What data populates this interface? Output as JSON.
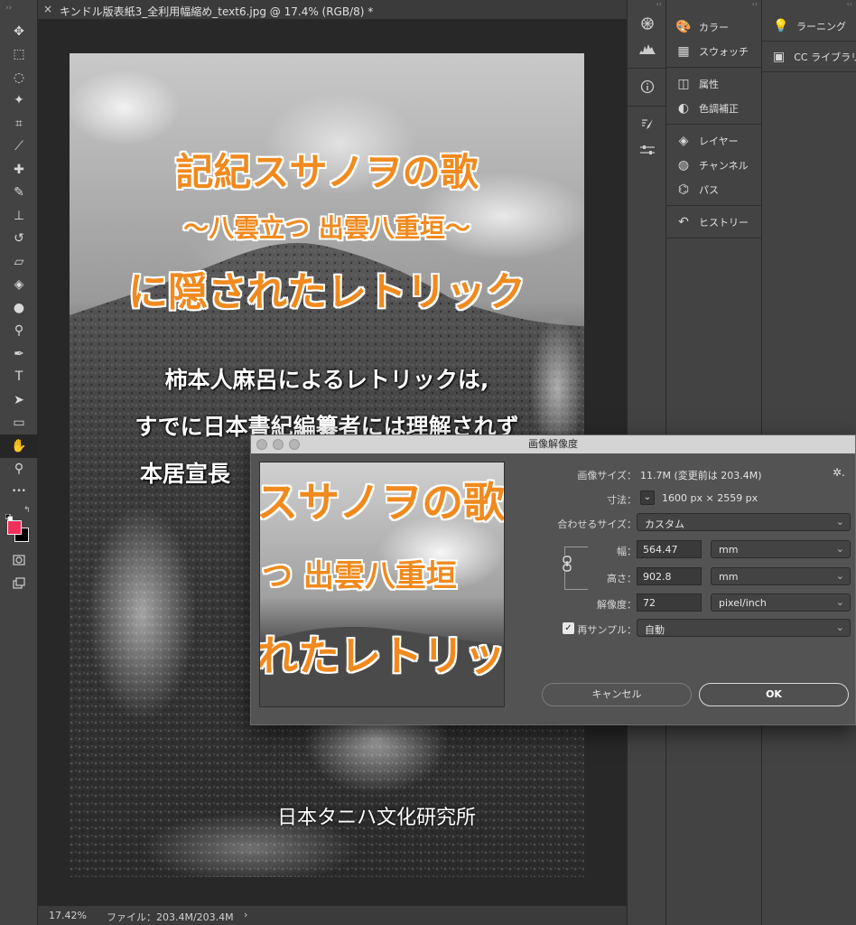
{
  "document": {
    "tab_title": "キンドル版表紙3_全利用幅縮め_text6.jpg @ 17.4% (RGB/8) *",
    "close_glyph": "×"
  },
  "cover": {
    "title_line1": "記紀スサノヲの歌",
    "title_line2": "～八雲立つ 出雲八重垣～",
    "title_line3": "に隠されたレトリック",
    "body_line1": "柿本人麻呂によるレトリックは,",
    "body_line2": "すでに日本書紀編纂者には理解されず",
    "body_line3": "本居宣長",
    "publisher": "日本タニハ文化研究所",
    "title_color": "#f08a1e"
  },
  "status_bar": {
    "zoom": "17.42%",
    "file_info": "ファイル：203.4M/203.4M",
    "arrow": "›"
  },
  "tools": [
    {
      "name": "move-tool",
      "glyph": "✥"
    },
    {
      "name": "marquee-tool",
      "glyph": "⬚"
    },
    {
      "name": "lasso-tool",
      "glyph": "◌"
    },
    {
      "name": "magic-wand-tool",
      "glyph": "✦"
    },
    {
      "name": "crop-tool",
      "glyph": "⌗"
    },
    {
      "name": "eyedropper-tool",
      "glyph": "⟋"
    },
    {
      "name": "healing-brush-tool",
      "glyph": "✚"
    },
    {
      "name": "brush-tool",
      "glyph": "✎"
    },
    {
      "name": "clone-stamp-tool",
      "glyph": "⊥"
    },
    {
      "name": "history-brush-tool",
      "glyph": "↺"
    },
    {
      "name": "eraser-tool",
      "glyph": "▱"
    },
    {
      "name": "paint-bucket-tool",
      "glyph": "◈"
    },
    {
      "name": "blur-tool",
      "glyph": "●"
    },
    {
      "name": "dodge-tool",
      "glyph": "⚲"
    },
    {
      "name": "pen-tool",
      "glyph": "✒"
    },
    {
      "name": "type-tool",
      "glyph": "T"
    },
    {
      "name": "path-selection-tool",
      "glyph": "➤"
    },
    {
      "name": "rectangle-tool",
      "glyph": "▭"
    },
    {
      "name": "hand-tool",
      "glyph": "✋",
      "active": true
    },
    {
      "name": "zoom-tool",
      "glyph": "⚲"
    },
    {
      "name": "more-tools",
      "glyph": "•••"
    }
  ],
  "colors": {
    "foreground": "#f0305a",
    "background": "#000000"
  },
  "panels": {
    "group1": [
      {
        "name": "color",
        "label": "カラー",
        "icon": "palette-icon",
        "glyph": "🎨"
      },
      {
        "name": "swatches",
        "label": "スウォッチ",
        "icon": "grid-icon",
        "glyph": "▦"
      }
    ],
    "group2": [
      {
        "name": "properties",
        "label": "属性",
        "icon": "properties-icon",
        "glyph": "◫"
      },
      {
        "name": "adjustments",
        "label": "色調補正",
        "icon": "adjustments-icon",
        "glyph": "◐"
      }
    ],
    "group3": [
      {
        "name": "layers",
        "label": "レイヤー",
        "icon": "layers-icon",
        "glyph": "◈"
      },
      {
        "name": "channels",
        "label": "チャンネル",
        "icon": "channels-icon",
        "glyph": "◍"
      },
      {
        "name": "paths",
        "label": "パス",
        "icon": "paths-icon",
        "glyph": "⌬"
      }
    ],
    "group4": [
      {
        "name": "history",
        "label": "ヒストリー",
        "icon": "history-icon",
        "glyph": "↶"
      }
    ]
  },
  "far_panels": [
    {
      "name": "learn",
      "label": "ラーニング",
      "icon": "lightbulb-icon",
      "glyph": "💡"
    },
    {
      "name": "cc-libraries",
      "label": "CC ライブラリ",
      "icon": "library-icon",
      "glyph": "▣"
    }
  ],
  "dialog": {
    "title": "画像解像度",
    "image_size_label": "画像サイズ：",
    "image_size_value": "11.7M (変更前は 203.4M)",
    "gear_glyph": "✲.",
    "dimensions_label": "寸法：",
    "dimensions_value": "1600 px × 2559 px",
    "fit_label": "合わせるサイズ：",
    "fit_value": "カスタム",
    "width_label": "幅：",
    "width_value": "564.47",
    "width_unit": "mm",
    "height_label": "高さ：",
    "height_value": "902.8",
    "height_unit": "mm",
    "resolution_label": "解像度：",
    "resolution_value": "72",
    "resolution_unit": "pixel/inch",
    "resample_label": "再サンプル：",
    "resample_value": "自動",
    "resample_checked": "✓",
    "cancel_label": "キャンセル",
    "ok_label": "OK",
    "preview_line1": "スサノヲの歌",
    "preview_line2": "つ 出雲八重垣",
    "preview_line3": "れたレトリック"
  }
}
